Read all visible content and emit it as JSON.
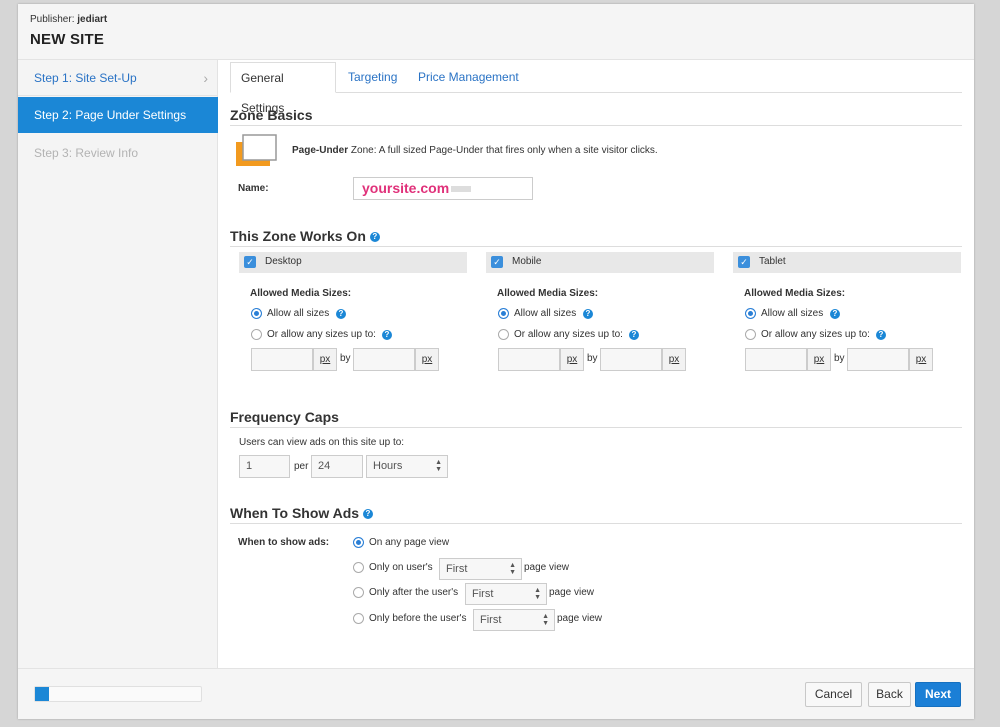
{
  "header": {
    "publisher_label": "Publisher:",
    "publisher_name": "jediart",
    "title": "NEW SITE"
  },
  "sidebar": {
    "steps": [
      {
        "label": "Step 1: Site Set-Up"
      },
      {
        "label": "Step 2: Page Under Settings"
      },
      {
        "label": "Step 3: Review Info"
      }
    ]
  },
  "tabs": [
    {
      "label": "General Settings"
    },
    {
      "label": "Targeting"
    },
    {
      "label": "Price Management"
    }
  ],
  "zone_basics": {
    "title": "Zone Basics",
    "zone_name_bold": "Page-Under",
    "zone_desc": " Zone: A full sized Page-Under that fires only when a site visitor clicks.",
    "name_label": "Name:",
    "name_value": "yoursite.com"
  },
  "works_on": {
    "title": "This Zone Works On",
    "devices": [
      {
        "label": "Desktop"
      },
      {
        "label": "Mobile"
      },
      {
        "label": "Tablet"
      }
    ],
    "allowed_label": "Allowed Media Sizes:",
    "allow_all": "Allow all sizes",
    "allow_upto": "Or allow any sizes up to:",
    "px": "px",
    "by": "by"
  },
  "frequency": {
    "title": "Frequency Caps",
    "text": "Users can view ads on this site up to:",
    "count": "1",
    "per": "per",
    "period": "24",
    "unit": "Hours"
  },
  "when": {
    "title": "When To Show Ads",
    "label": "When to show ads:",
    "options": [
      {
        "text": "On any page view"
      },
      {
        "text": "Only on user's",
        "select": "First",
        "suffix": "page view"
      },
      {
        "text": "Only after the user's",
        "select": "First",
        "suffix": "page view"
      },
      {
        "text": "Only before the user's",
        "select": "First",
        "suffix": "page view"
      }
    ]
  },
  "footer": {
    "cancel": "Cancel",
    "back": "Back",
    "next": "Next",
    "progress": 0.08
  },
  "colors": {
    "accent": "#1b87d6",
    "link": "#2a73c5",
    "brand_pink": "#e0317a"
  }
}
